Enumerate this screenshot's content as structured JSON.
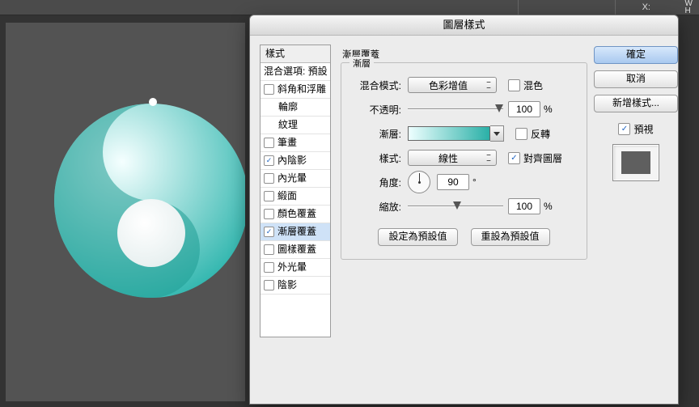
{
  "topbar": {
    "x_label": "X:"
  },
  "dialog": {
    "title": "圖層樣式",
    "styles_header": "樣式",
    "blend_options": "混合選項: 預設",
    "effects": {
      "bevel": "斜角和浮雕",
      "contour": "輪廓",
      "texture": "紋理",
      "stroke": "筆畫",
      "inner_shadow": "內陰影",
      "inner_glow": "內光暈",
      "satin": "緞面",
      "color_overlay": "顏色覆蓋",
      "gradient_overlay": "漸層覆蓋",
      "pattern_overlay": "圖樣覆蓋",
      "outer_glow": "外光暈",
      "drop_shadow": "陰影"
    }
  },
  "section": {
    "heading": "漸層覆蓋",
    "legend": "漸層",
    "blend_mode_label": "混合模式:",
    "blend_mode_value": "色彩增值",
    "dither_label": "混色",
    "opacity_label": "不透明:",
    "opacity_value": "100",
    "percent": "%",
    "gradient_label": "漸層:",
    "reverse_label": "反轉",
    "style_label": "樣式:",
    "style_value": "線性",
    "align_label": "對齊圖層",
    "angle_label": "角度:",
    "angle_value": "90",
    "degree": "°",
    "scale_label": "縮放:",
    "scale_value": "100",
    "make_default": "設定為預設值",
    "reset_default": "重設為預設值"
  },
  "side": {
    "ok": "確定",
    "cancel": "取消",
    "new_style": "新增樣式...",
    "preview": "預視"
  }
}
